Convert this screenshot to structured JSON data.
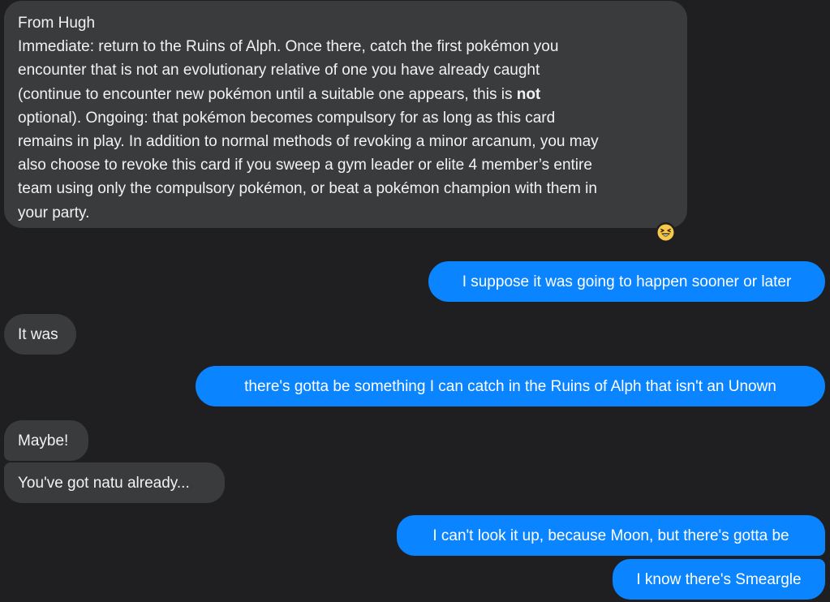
{
  "messages": [
    {
      "id": "msg-1",
      "direction": "incoming",
      "lines": [
        "From Hugh",
        "Immediate: return to the Ruins of Alph. Once there, catch the first pokémon you",
        "encounter that is not an evolutionary relative of one you have already caught",
        "(continue to encounter new pokémon until a suitable one appears, this is ",
        "optional). Ongoing: that pokémon becomes compulsory for as long as this card",
        "remains in play. In addition to normal methods of revoking a minor arcanum, you may",
        "also choose to revoke this card if you sweep a gym leader or elite 4 member’s entire",
        "team using only the compulsory pokémon, or beat a pokémon champion with them in",
        "your party."
      ],
      "bold_word": "not",
      "reaction": "laughing-emoji"
    },
    {
      "id": "msg-2",
      "direction": "outgoing",
      "text": "I suppose it was going to happen sooner or later"
    },
    {
      "id": "msg-3",
      "direction": "incoming",
      "text": "It was"
    },
    {
      "id": "msg-4",
      "direction": "outgoing",
      "text": "there's gotta be something I can catch in the Ruins of Alph that isn't an Unown"
    },
    {
      "id": "msg-5",
      "direction": "incoming",
      "text": "Maybe!"
    },
    {
      "id": "msg-6",
      "direction": "incoming",
      "text": "You've got natu already..."
    },
    {
      "id": "msg-7",
      "direction": "outgoing",
      "text": "I can't look it up, because Moon, but there's gotta be"
    },
    {
      "id": "msg-8",
      "direction": "outgoing",
      "text": "I know there's Smeargle"
    }
  ],
  "colors": {
    "background": "#1f1f21",
    "incoming_bubble": "#3a3b3d",
    "outgoing_bubble": "#0a84ff"
  }
}
